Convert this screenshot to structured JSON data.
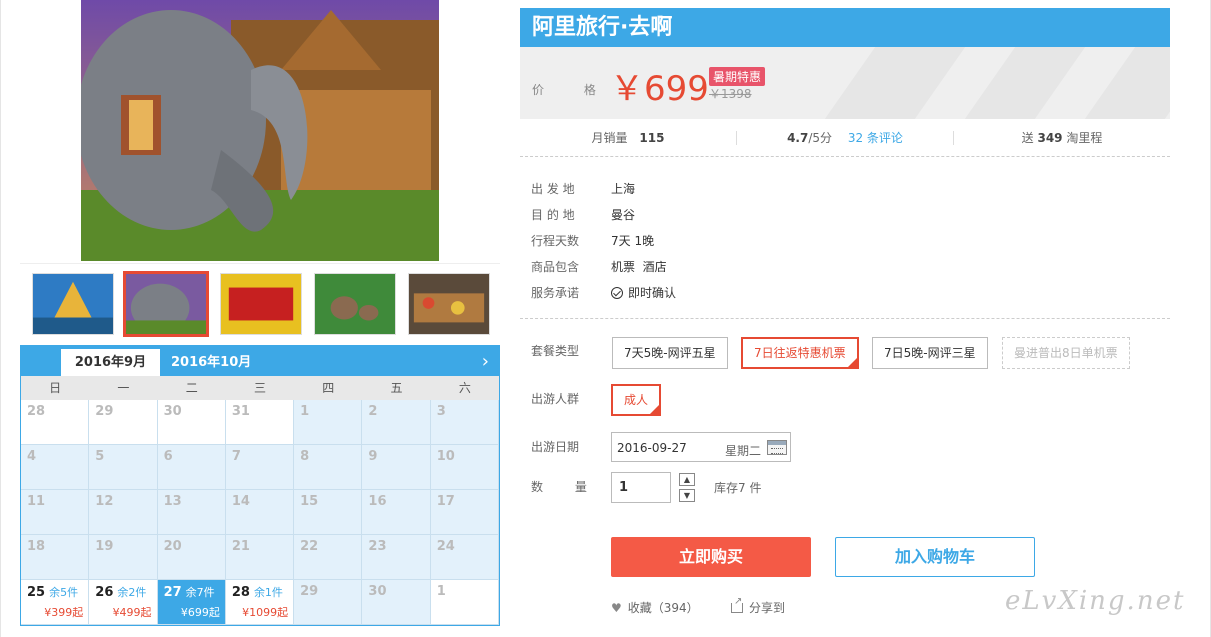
{
  "product": {
    "title": "阿里旅行·去啊",
    "price_label": "价 格",
    "price": "￥699",
    "badge": "暑期特惠",
    "original_price": "￥1398"
  },
  "stats": {
    "sales_label": "月销量",
    "sales_value": "115",
    "rating": "4.7",
    "rating_suffix": "/5分",
    "reviews_link": "32 条评论",
    "points_prefix": "送",
    "points_value": "349",
    "points_suffix": "淘里程"
  },
  "info": [
    {
      "label": "出 发 地",
      "value": "上海"
    },
    {
      "label": "目 的 地",
      "value": "曼谷"
    },
    {
      "label": "行程天数",
      "value": "7天 1晚"
    },
    {
      "label": "商品包含",
      "value": "机票  酒店"
    },
    {
      "label": "服务承诺",
      "value": "即时确认"
    }
  ],
  "options": {
    "package_label": "套餐类型",
    "packages": [
      "7天5晚-网评五星",
      "7日往返特惠机票",
      "7日5晚-网评三星",
      "曼进普出8日单机票"
    ],
    "traveler_label": "出游人群",
    "traveler": "成人",
    "date_label": "出游日期",
    "date_value": "2016-09-27",
    "weekday": "星期二",
    "qty_label": "数 量",
    "qty_value": "1",
    "stock_text": "库存7 件"
  },
  "actions": {
    "buy": "立即购买",
    "cart": "加入购物车",
    "favorite": "收藏（394）",
    "share": "分享到"
  },
  "calendar": {
    "tab_current": "2016年9月",
    "tab_next": "2016年10月",
    "next_arrow": "›",
    "weekdays": [
      "日",
      "一",
      "二",
      "三",
      "四",
      "五",
      "六"
    ],
    "rows": [
      [
        "28",
        "29",
        "30",
        "31",
        "1",
        "2",
        "3"
      ],
      [
        "4",
        "5",
        "6",
        "7",
        "8",
        "9",
        "10"
      ],
      [
        "11",
        "12",
        "13",
        "14",
        "15",
        "16",
        "17"
      ],
      [
        "18",
        "19",
        "20",
        "21",
        "22",
        "23",
        "24"
      ]
    ],
    "last_row": [
      {
        "day": "25",
        "stock": "余5件",
        "price": "¥399起"
      },
      {
        "day": "26",
        "stock": "余2件",
        "price": "¥499起"
      },
      {
        "day": "27",
        "stock": "余7件",
        "price": "¥699起"
      },
      {
        "day": "28",
        "stock": "余1件",
        "price": "¥1099起"
      },
      {
        "day": "29"
      },
      {
        "day": "30"
      },
      {
        "day": "1"
      }
    ]
  },
  "watermark": "eLvXing.net",
  "colors": {
    "accent": "#3da8e6",
    "price": "#e64a33",
    "buy": "#f45a46",
    "badge": "#e8546a"
  }
}
